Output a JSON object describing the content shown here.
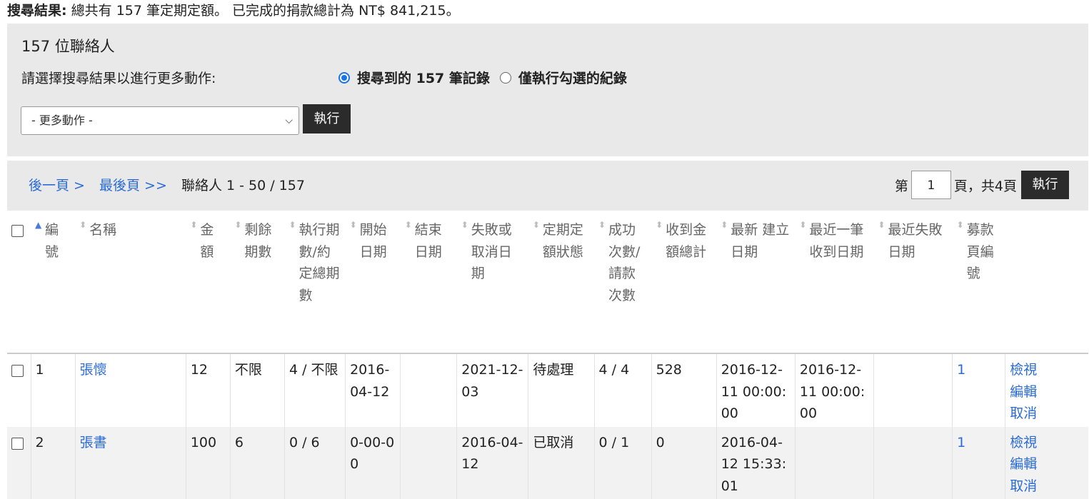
{
  "summary": {
    "label": "搜尋結果:",
    "text": "總共有 157 筆定期定額。 已完成的捐款總計為 NT$ 841,215。"
  },
  "actions": {
    "contacts_count": "157 位聯絡人",
    "select_prompt": "請選擇搜尋結果以進行更多動作:",
    "radio_all": "搜尋到的 157 筆記錄",
    "radio_selected": "僅執行勾選的紀錄",
    "select_value": "- 更多動作 -",
    "go_label": "執行"
  },
  "pager": {
    "next": "後一頁 >",
    "last": "最後頁 >>",
    "range": "聯絡人 1 - 50 / 157",
    "page_prefix": "第",
    "page_value": "1",
    "page_suffix": "頁，共4頁",
    "go_label": "執行"
  },
  "columns": [
    "編號",
    "名稱",
    "金額",
    "剩餘期數",
    "執行期數/約定總期數",
    "開始日期",
    "結束日期",
    "失敗或取消日期",
    "定期定額狀態",
    "成功次數/請款次數",
    "收到金額總計",
    "最新 建立日期",
    "最近一筆收到日期",
    "最近失敗日期",
    "募款頁編號"
  ],
  "rows": [
    {
      "id": "1",
      "name": "張懷",
      "amount": "12",
      "remaining": "不限",
      "executed": "4 / 不限",
      "start": "2016-04-12",
      "end": "",
      "failed": "2021-12-03",
      "status": "待處理",
      "success": "4 / 4",
      "received": "528",
      "created": "2016-12-11 00:00:00",
      "last_received": "2016-12-11 00:00:00",
      "last_failed": "",
      "page_id": "1",
      "view": "檢視",
      "edit": "編輯",
      "cancel": "取消"
    },
    {
      "id": "2",
      "name": "張書",
      "amount": "100",
      "remaining": "6",
      "executed": "0 / 6",
      "start": "0-00-00",
      "end": "",
      "failed": "2016-04-12",
      "status": "已取消",
      "success": "0 / 1",
      "received": "0",
      "created": "2016-04-12 15:33:01",
      "last_received": "",
      "last_failed": "",
      "page_id": "1",
      "view": "檢視",
      "edit": "編輯",
      "cancel": "取消"
    }
  ]
}
